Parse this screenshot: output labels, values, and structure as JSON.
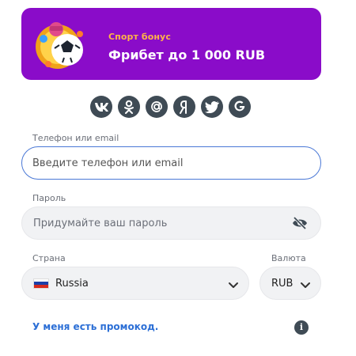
{
  "banner": {
    "subtitle": "Спорт бонус",
    "title": "Фрибет до 1 000 RUB",
    "art_icon": "soccer-ball-gift-icon",
    "bg_color": "#8a0cc9",
    "subtitle_color": "#ffb347"
  },
  "socials": [
    {
      "name": "vk-icon",
      "glyph": "vk"
    },
    {
      "name": "odnoklassniki-icon",
      "glyph": "ok"
    },
    {
      "name": "mail-ru-icon",
      "glyph": "@"
    },
    {
      "name": "yandex-icon",
      "glyph": "Я"
    },
    {
      "name": "twitter-icon",
      "glyph": "bird"
    },
    {
      "name": "google-icon",
      "glyph": "G"
    }
  ],
  "form": {
    "login_label": "Телефон или email",
    "login_placeholder": "Введите телефон или email",
    "login_value": "",
    "password_label": "Пароль",
    "password_placeholder": "Придумайте ваш пароль",
    "password_value": "",
    "password_toggle_icon": "eye-slash-icon",
    "country_label": "Страна",
    "country_value": "Russia",
    "country_flag": "russia-flag-icon",
    "currency_label": "Валюта",
    "currency_value": "RUB",
    "promo_link": "У меня есть промокод.",
    "info_icon": "info-icon",
    "accent_color": "#2c6fd6"
  }
}
